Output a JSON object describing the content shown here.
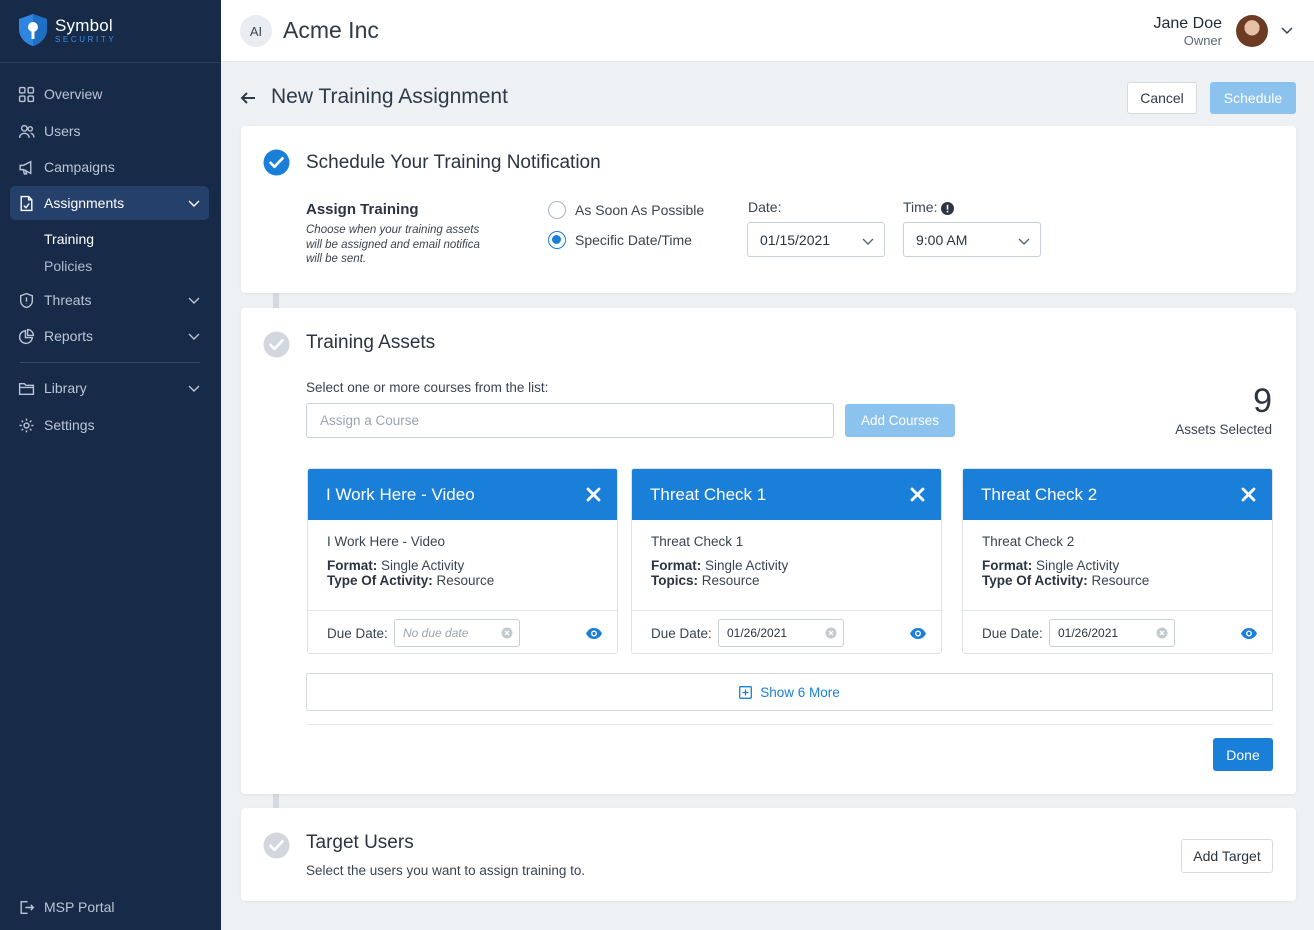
{
  "brand": {
    "name": "Symbol",
    "tagline": "SECURITY"
  },
  "sidebar": {
    "items": [
      {
        "label": "Overview",
        "icon": "grid-icon"
      },
      {
        "label": "Users",
        "icon": "users-icon"
      },
      {
        "label": "Campaigns",
        "icon": "megaphone-icon"
      },
      {
        "label": "Assignments",
        "icon": "document-icon",
        "active": true
      },
      {
        "label": "Threats",
        "icon": "shield-icon"
      },
      {
        "label": "Reports",
        "icon": "pie-chart-icon"
      },
      {
        "label": "Library",
        "icon": "folder-icon"
      },
      {
        "label": "Settings",
        "icon": "gear-icon"
      }
    ],
    "subitems": [
      {
        "label": "Training",
        "active": true
      },
      {
        "label": "Policies"
      }
    ],
    "footer": {
      "label": "MSP Portal",
      "icon": "exit-icon"
    }
  },
  "topbar": {
    "org_initials": "AI",
    "org_name": "Acme Inc",
    "user_name": "Jane Doe",
    "user_role": "Owner"
  },
  "page": {
    "title": "New Training Assignment",
    "cancel_label": "Cancel",
    "schedule_label": "Schedule"
  },
  "schedule_section": {
    "title": "Schedule Your Training Notification",
    "assign_label": "Assign Training",
    "assign_desc": "Choose when your training assets will be assigned and email notifica will be sent.",
    "option_asap": "As Soon As Possible",
    "option_specific": "Specific Date/Time",
    "selected_option": "Specific Date/Time",
    "date_label": "Date:",
    "date_value": "01/15/2021",
    "time_label": "Time:",
    "time_value": "9:00 AM"
  },
  "assets_section": {
    "title": "Training Assets",
    "select_label": "Select one or more courses from the list:",
    "input_placeholder": "Assign a Course",
    "add_courses_label": "Add Courses",
    "assets_count": "9",
    "assets_count_label": "Assets Selected",
    "courses": [
      {
        "title": "I Work Here - Video",
        "name": "I Work Here - Video",
        "field1_key": "Format:",
        "field1_val": "Single Activity",
        "field2_key": "Type Of Activity:",
        "field2_val": "Resource",
        "due_label": "Due Date:",
        "due_value": "No due date"
      },
      {
        "title": "Threat Check 1",
        "name": "Threat Check 1",
        "field1_key": "Format:",
        "field1_val": "Single Activity",
        "field2_key": "Topics:",
        "field2_val": "Resource",
        "due_label": "Due Date:",
        "due_value": "01/26/2021"
      },
      {
        "title": "Threat Check 2",
        "name": "Threat Check 2",
        "field1_key": "Format:",
        "field1_val": "Single Activity",
        "field2_key": "Type Of Activity:",
        "field2_val": "Resource",
        "due_label": "Due Date:",
        "due_value": "01/26/2021"
      }
    ],
    "show_more_label": "Show 6 More",
    "done_label": "Done"
  },
  "target_section": {
    "title": "Target Users",
    "desc": "Select the users you want to assign training to.",
    "add_target_label": "Add Target"
  },
  "colors": {
    "primary": "#1a7fd9",
    "primary_disabled": "#8cc2ee",
    "sidebar_bg": "#172b48",
    "sidebar_active": "#25406a"
  }
}
